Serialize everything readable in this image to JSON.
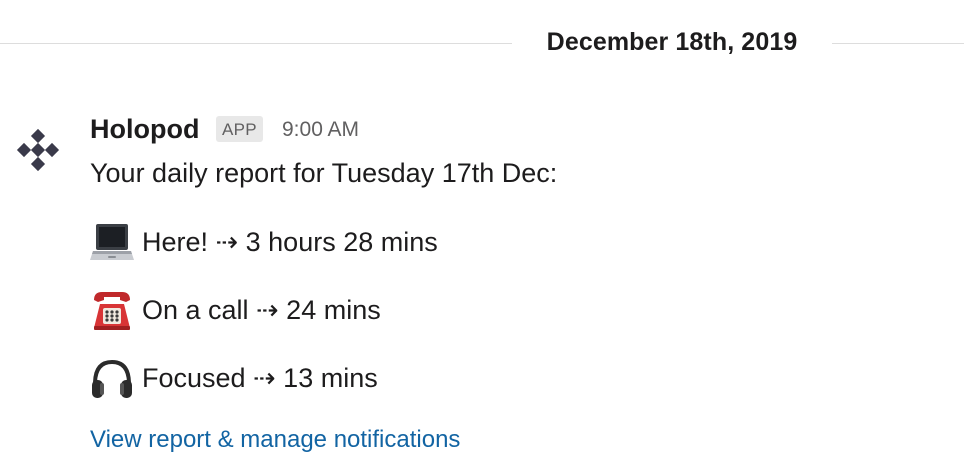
{
  "date_divider": {
    "label": "December 18th, 2019"
  },
  "message": {
    "sender": "Holopod",
    "badge": "APP",
    "time": "9:00 AM",
    "intro": "Your daily report for Tuesday 17th Dec:",
    "stats": [
      {
        "icon": "laptop-icon",
        "text": "Here! ⇢ 3 hours 28 mins"
      },
      {
        "icon": "telephone-icon",
        "text": "On a call ⇢ 24 mins"
      },
      {
        "icon": "headphones-icon",
        "text": "Focused ⇢ 13 mins"
      }
    ],
    "link_text": "View report & manage notifications"
  },
  "colors": {
    "link": "#1264a3",
    "text": "#1d1c1d",
    "muted": "#616061",
    "divider": "#dddddd",
    "avatar": "#3a3a4a"
  }
}
